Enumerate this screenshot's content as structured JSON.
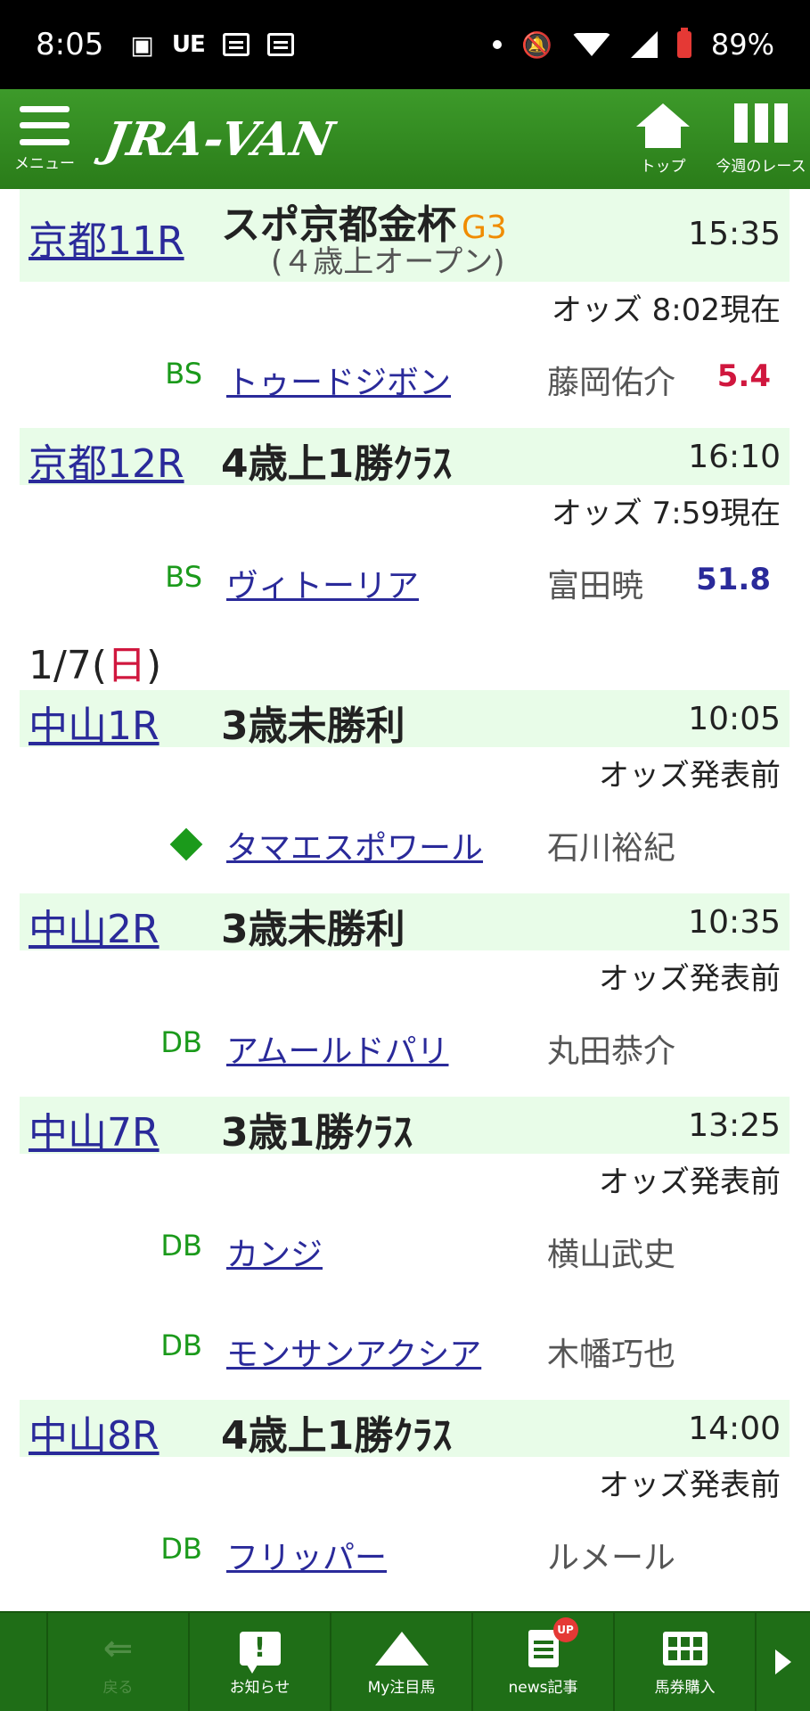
{
  "status_bar": {
    "time": "8:05",
    "ue": "UE",
    "battery": "89%"
  },
  "header": {
    "menu_label": "メニュー",
    "logo": "JRA-VAN",
    "top_label": "トップ",
    "races_label": "今週のレース"
  },
  "races": [
    {
      "link": "京都11R",
      "name": "スポ京都金杯",
      "grade": "G3",
      "sub": "(４歳上オープン)",
      "time": "15:35",
      "odds_status": "オッズ 8:02現在",
      "horses": [
        {
          "tag": "BS",
          "horse": "トゥードジボン",
          "jockey": "藤岡佑介",
          "odds": "5.4"
        }
      ]
    },
    {
      "link": "京都12R",
      "name": "4歳上1勝ｸﾗｽ",
      "time": "16:10",
      "odds_status": "オッズ 7:59現在",
      "horses": [
        {
          "tag": "BS",
          "horse": "ヴィトーリア",
          "jockey": "富田暁",
          "odds": "51.8"
        }
      ]
    },
    {
      "link": "中山1R",
      "name": "3歳未勝利",
      "time": "10:05",
      "odds_status": "オッズ発表前",
      "horses": [
        {
          "tag": "◆",
          "horse": "タマエスポワール",
          "jockey": "石川裕紀"
        }
      ]
    },
    {
      "link": "中山2R",
      "name": "3歳未勝利",
      "time": "10:35",
      "odds_status": "オッズ発表前",
      "horses": [
        {
          "tag": "DB",
          "horse": "アムールドパリ",
          "jockey": "丸田恭介"
        }
      ]
    },
    {
      "link": "中山7R",
      "name": "3歳1勝ｸﾗｽ",
      "time": "13:25",
      "odds_status": "オッズ発表前",
      "horses": [
        {
          "tag": "DB",
          "horse": "カンジ",
          "jockey": "横山武史"
        },
        {
          "tag": "DB",
          "horse": "モンサンアクシア",
          "jockey": "木幡巧也"
        }
      ]
    },
    {
      "link": "中山8R",
      "name": "4歳上1勝ｸﾗｽ",
      "time": "14:00",
      "odds_status": "オッズ発表前",
      "horses": [
        {
          "tag": "DB",
          "horse": "フリッパー",
          "jockey": "ルメール"
        }
      ]
    }
  ],
  "date_header": {
    "date": "1/7(",
    "dow": "日",
    "close": ")"
  },
  "colors": {
    "header_green": "#2a7c19",
    "row_bg": "#e8fce8",
    "link_blue": "#2a2a9a",
    "odds_red": "#d0173e",
    "tag_green": "#1b9a1b",
    "grade_orange": "#f08c00"
  },
  "bottom_nav": {
    "back": "戻る",
    "news": "お知らせ",
    "my_horse": "My注目馬",
    "articles": "news記事",
    "articles_badge": "UP",
    "betting": "馬券購入"
  }
}
